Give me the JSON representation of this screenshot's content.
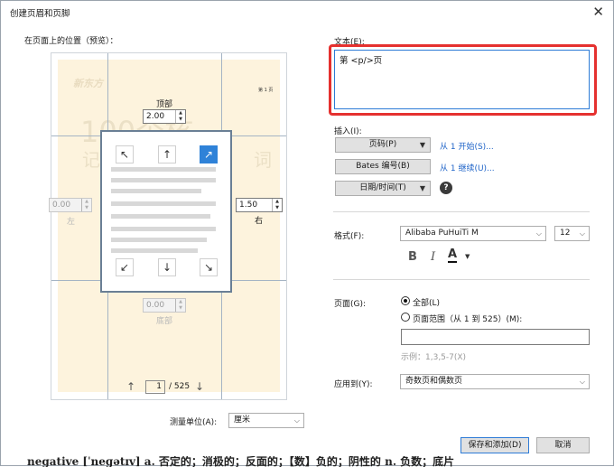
{
  "dialog": {
    "title": "创建页眉和页脚"
  },
  "preview": {
    "heading": "在页面上的位置（预览）：",
    "faded": {
      "brand": "新东方",
      "page_mark": "第 1 页",
      "big": "100个核",
      "sub": "记、",
      "sub2": "词"
    },
    "top": {
      "label": "顶部",
      "value": "2.00"
    },
    "left": {
      "label": "左",
      "value": "0.00"
    },
    "right": {
      "label": "右",
      "value": "1.50"
    },
    "bottom": {
      "label": "底部",
      "value": "0.00"
    },
    "pager": {
      "current": "1",
      "total": "/ 525"
    }
  },
  "measure": {
    "label": "测量单位(A):",
    "value": "厘米"
  },
  "text": {
    "label": "文本(E):",
    "value": "第 <p/>页"
  },
  "insert": {
    "label": "插入(I):",
    "page_code": "页码(P)",
    "page_code_link": "从 1 开始(S)...",
    "bates": "Bates 编号(B)",
    "bates_link": "从 1 继续(U)...",
    "datetime": "日期/时间(T)"
  },
  "format": {
    "label": "格式(F):",
    "font": "Alibaba PuHuiTi M",
    "size": "12",
    "bold": "B",
    "italic": "I",
    "color": "A"
  },
  "page": {
    "label": "页面(G):",
    "all": "全部(L)",
    "range": "页面范围（从 1 到 525）(M):",
    "example": "示例：1,3,5-7(X)"
  },
  "apply": {
    "label": "应用到(Y):",
    "value": "奇数页和偶数页"
  },
  "buttons": {
    "save": "保存和添加(D)",
    "cancel": "取消"
  },
  "underlay_text": "negative [ˈneɡətɪv] a. 否定的；消极的；反面的；【数】负的；阴性的 n. 负数；底片"
}
